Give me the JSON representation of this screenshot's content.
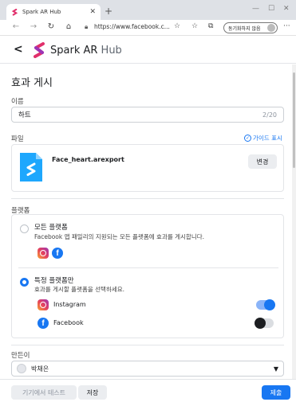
{
  "browser": {
    "tab_title": "Spark AR Hub",
    "url": "https://www.facebook.c...",
    "sync_label": "동기화하지 않음"
  },
  "header": {
    "brand_main": "Spark AR",
    "brand_sub": " Hub"
  },
  "form": {
    "title": "효과 게시",
    "name": {
      "label": "이름",
      "value": "하트",
      "counter": "2/20"
    },
    "file": {
      "label": "파일",
      "guide_link": "가이드 표시",
      "file_name": "Face_heart.arexport",
      "change_label": "변경"
    },
    "platform": {
      "label": "플랫폼",
      "all": {
        "title": "모든 플랫폼",
        "desc": "Facebook 앱 패밀리의 지원되는 모든 플랫폼에 효과를 게시합니다.",
        "selected": false
      },
      "specific": {
        "title": "특정 플랫폼만",
        "desc": "효과를 게시할 플랫폼을 선택하세요.",
        "selected": true
      },
      "items": [
        {
          "name": "Instagram",
          "enabled": true
        },
        {
          "name": "Facebook",
          "enabled": false
        }
      ]
    },
    "creator": {
      "label": "만든이",
      "value": "박채은"
    }
  },
  "footer": {
    "test_label": "기기에서 테스트",
    "save_label": "저장",
    "publish_label": "제출"
  },
  "colors": {
    "accent": "#1877f2",
    "toggle_track_on": "#8ab4f8"
  }
}
